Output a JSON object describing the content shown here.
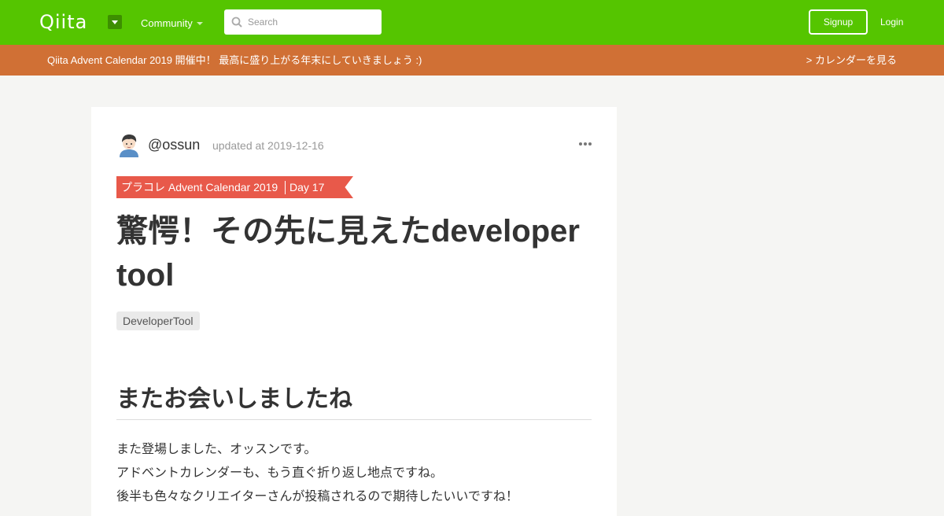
{
  "header": {
    "logo": "Qiita",
    "community_label": "Community",
    "search_placeholder": "Search",
    "search_value": "",
    "signup_label": "Signup",
    "login_label": "Login",
    "brand_color": "#55c500"
  },
  "banner": {
    "text": "Qiita Advent Calendar 2019 開催中！ 最高に盛り上がる年末にしていきましょう :)",
    "link": "> カレンダーを見る",
    "color": "#d07035"
  },
  "article": {
    "author": "@ossun",
    "updated": "updated at 2019-12-16",
    "calendar_title": "プラコレ Advent Calendar 2019",
    "calendar_day": "Day 17",
    "title": "驚愕！その先に見えたdeveloper tool",
    "tags": [
      "DeveloperTool"
    ],
    "heading": "またお会いしましたね",
    "paragraphs": [
      "また登場しました、オッスンです。",
      "アドベントカレンダーも、もう直ぐ折り返し地点ですね。",
      "後半も色々なクリエイターさんが投稿されるので期待したいいですね！"
    ],
    "ribbon_color": "#e8594a"
  },
  "icons": {
    "menu": "caret-down-icon",
    "search": "search-icon",
    "more": "more-horizontal-icon",
    "avatar": "avatar-icon"
  }
}
